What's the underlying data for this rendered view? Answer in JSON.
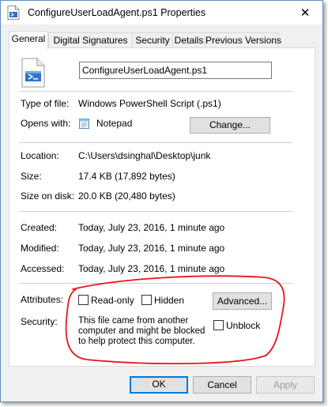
{
  "window": {
    "title": "ConfigureUserLoadAgent.ps1 Properties",
    "close_label": "✕"
  },
  "tabs": [
    {
      "label": "General",
      "active": true
    },
    {
      "label": "Digital Signatures",
      "active": false
    },
    {
      "label": "Security",
      "active": false
    },
    {
      "label": "Details",
      "active": false
    },
    {
      "label": "Previous Versions",
      "active": false
    }
  ],
  "general": {
    "file_name": "ConfigureUserLoadAgent.ps1",
    "type_label": "Type of file:",
    "type_value": "Windows PowerShell Script (.ps1)",
    "opens_label": "Opens with:",
    "opens_value": "Notepad",
    "change_label": "Change...",
    "location_label": "Location:",
    "location_value": "C:\\Users\\dsinghal\\Desktop\\junk",
    "size_label": "Size:",
    "size_value": "17.4 KB (17,892 bytes)",
    "size_disk_label": "Size on disk:",
    "size_disk_value": "20.0 KB (20,480 bytes)",
    "created_label": "Created:",
    "created_value": "Today, July 23, 2016, 1 minute ago",
    "modified_label": "Modified:",
    "modified_value": "Today, July 23, 2016, 1 minute ago",
    "accessed_label": "Accessed:",
    "accessed_value": "Today, July 23, 2016, 1 minute ago",
    "attributes_label": "Attributes:",
    "readonly_label": "Read-only",
    "readonly_checked": false,
    "hidden_label": "Hidden",
    "hidden_checked": false,
    "advanced_label": "Advanced...",
    "security_label": "Security:",
    "security_note": "This file came from another computer and might be blocked to help protect this computer.",
    "unblock_label": "Unblock",
    "unblock_checked": false
  },
  "footer": {
    "ok_label": "OK",
    "cancel_label": "Cancel",
    "apply_label": "Apply"
  },
  "colors": {
    "annotation_red": "#e8141c",
    "window_border": "#5b8fc7",
    "default_button_border": "#0078d7"
  },
  "icons": {
    "title": "powershell-script-file-icon",
    "large": "powershell-script-file-icon",
    "opens_with": "notepad-icon",
    "close": "close-icon"
  }
}
